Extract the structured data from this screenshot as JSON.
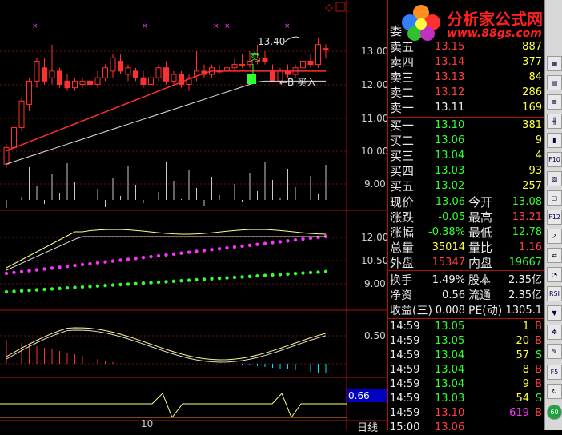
{
  "logo": {
    "title": "分析家公式网",
    "url": "www.88gs.com"
  },
  "weibi_label": "委",
  "asks": [
    {
      "label": "卖五",
      "price": "13.15",
      "vol": "887"
    },
    {
      "label": "卖四",
      "price": "13.14",
      "vol": "377"
    },
    {
      "label": "卖三",
      "price": "13.13",
      "vol": "84"
    },
    {
      "label": "卖二",
      "price": "13.12",
      "vol": "286"
    },
    {
      "label": "卖一",
      "price": "13.11",
      "vol": "169"
    }
  ],
  "bids": [
    {
      "label": "买一",
      "price": "13.10",
      "vol": "381"
    },
    {
      "label": "买二",
      "price": "13.06",
      "vol": "9"
    },
    {
      "label": "买三",
      "price": "13.04",
      "vol": "4"
    },
    {
      "label": "买四",
      "price": "13.03",
      "vol": "93"
    },
    {
      "label": "买五",
      "price": "13.02",
      "vol": "257"
    }
  ],
  "stats": [
    {
      "l1": "现价",
      "v1": "13.06",
      "l2": "今开",
      "v2": "13.08"
    },
    {
      "l1": "涨跌",
      "v1": "-0.05",
      "l2": "最高",
      "v2": "13.21"
    },
    {
      "l1": "涨幅",
      "v1": "-0.38%",
      "l2": "最低",
      "v2": "12.78"
    },
    {
      "l1": "总量",
      "v1": "35014",
      "l2": "量比",
      "v2": "1.16"
    },
    {
      "l1": "外盘",
      "v1": "15347",
      "l2": "内盘",
      "v2": "19667"
    }
  ],
  "fundamentals": [
    {
      "l1": "换手",
      "v1": "1.49%",
      "l2": "股本",
      "v2": "2.35亿"
    },
    {
      "l1": "净资",
      "v1": "0.56",
      "l2": "流通",
      "v2": "2.35亿"
    },
    {
      "l1": "收益(三)",
      "v1": "0.008",
      "l2": "PE(动)",
      "v2": "1305.1"
    }
  ],
  "ticks": [
    {
      "time": "14:59",
      "price": "13.05",
      "vol": "1",
      "side": "B"
    },
    {
      "time": "14:59",
      "price": "13.05",
      "vol": "20",
      "side": "B"
    },
    {
      "time": "14:59",
      "price": "13.04",
      "vol": "57",
      "side": "S"
    },
    {
      "time": "14:59",
      "price": "13.04",
      "vol": "8",
      "side": "B"
    },
    {
      "time": "14:59",
      "price": "13.04",
      "vol": "9",
      "side": "B"
    },
    {
      "time": "14:59",
      "price": "13.03",
      "vol": "54",
      "side": "S"
    },
    {
      "time": "14:59",
      "price": "13.10",
      "vol": "619",
      "side": "B"
    },
    {
      "time": "15:00",
      "price": "13.06",
      "vol": "",
      "side": ""
    }
  ],
  "chart": {
    "price_axis": [
      "13.00",
      "12.00",
      "11.00",
      "10.00",
      "9.00"
    ],
    "ind1_axis": [
      "12.00",
      "10.50",
      "9.00"
    ],
    "ind2_axis": [
      "0.50"
    ],
    "ind3_value": "0.66",
    "date_label": "10",
    "high_annotation": "13.40",
    "sell_label": "卖",
    "buy_label": "←B 买入",
    "period_label": "日线"
  },
  "toolbar_icons": [
    "F10",
    "F12",
    "RSI",
    "F5",
    "60"
  ],
  "colors": {
    "up": "#ff3030",
    "down": "#30ff30",
    "grid": "#b01010",
    "ma": "#e0e0e0"
  }
}
